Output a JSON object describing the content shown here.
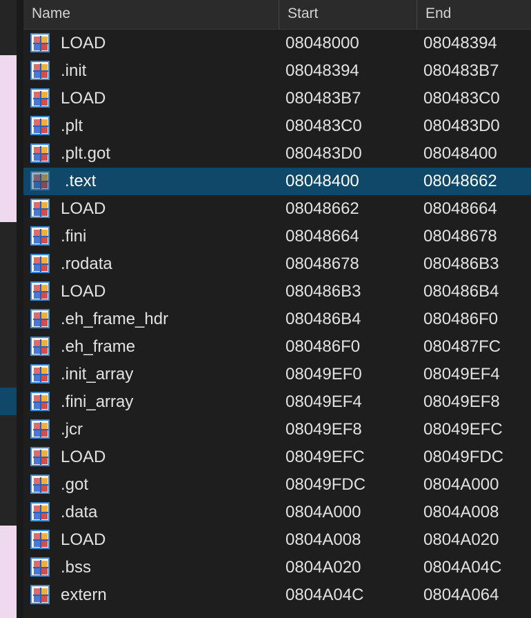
{
  "colors": {
    "background": "#1e1e1e",
    "header": "#2b2b2b",
    "selection": "#0f4868",
    "text": "#e2e2e2",
    "strip_highlight": "#efd9ee",
    "strip_selection": "#0f4868"
  },
  "header": {
    "name": "Name",
    "start": "Start",
    "end": "End"
  },
  "segments": [
    {
      "name": "LOAD",
      "start": "08048000",
      "end": "08048394",
      "icon": "segment-icon"
    },
    {
      "name": ".init",
      "start": "08048394",
      "end": "080483B7",
      "icon": "segment-icon"
    },
    {
      "name": "LOAD",
      "start": "080483B7",
      "end": "080483C0",
      "icon": "segment-icon"
    },
    {
      "name": ".plt",
      "start": "080483C0",
      "end": "080483D0",
      "icon": "segment-icon"
    },
    {
      "name": ".plt.got",
      "start": "080483D0",
      "end": "08048400",
      "icon": "segment-icon"
    },
    {
      "name": ".text",
      "start": "08048400",
      "end": "08048662",
      "icon": "segment-icon",
      "selected": true
    },
    {
      "name": "LOAD",
      "start": "08048662",
      "end": "08048664",
      "icon": "segment-icon"
    },
    {
      "name": ".fini",
      "start": "08048664",
      "end": "08048678",
      "icon": "segment-icon"
    },
    {
      "name": ".rodata",
      "start": "08048678",
      "end": "080486B3",
      "icon": "segment-icon"
    },
    {
      "name": "LOAD",
      "start": "080486B3",
      "end": "080486B4",
      "icon": "segment-icon"
    },
    {
      "name": ".eh_frame_hdr",
      "start": "080486B4",
      "end": "080486F0",
      "icon": "segment-icon"
    },
    {
      "name": ".eh_frame",
      "start": "080486F0",
      "end": "080487FC",
      "icon": "segment-icon"
    },
    {
      "name": ".init_array",
      "start": "08049EF0",
      "end": "08049EF4",
      "icon": "segment-icon"
    },
    {
      "name": ".fini_array",
      "start": "08049EF4",
      "end": "08049EF8",
      "icon": "segment-icon"
    },
    {
      "name": ".jcr",
      "start": "08049EF8",
      "end": "08049EFC",
      "icon": "segment-icon"
    },
    {
      "name": "LOAD",
      "start": "08049EFC",
      "end": "08049FDC",
      "icon": "segment-icon"
    },
    {
      "name": ".got",
      "start": "08049FDC",
      "end": "0804A000",
      "icon": "segment-icon"
    },
    {
      "name": ".data",
      "start": "0804A000",
      "end": "0804A008",
      "icon": "segment-icon"
    },
    {
      "name": "LOAD",
      "start": "0804A008",
      "end": "0804A020",
      "icon": "segment-icon"
    },
    {
      "name": ".bss",
      "start": "0804A020",
      "end": "0804A04C",
      "icon": "segment-icon"
    },
    {
      "name": "extern",
      "start": "0804A04C",
      "end": "0804A064",
      "icon": "segment-icon"
    }
  ]
}
